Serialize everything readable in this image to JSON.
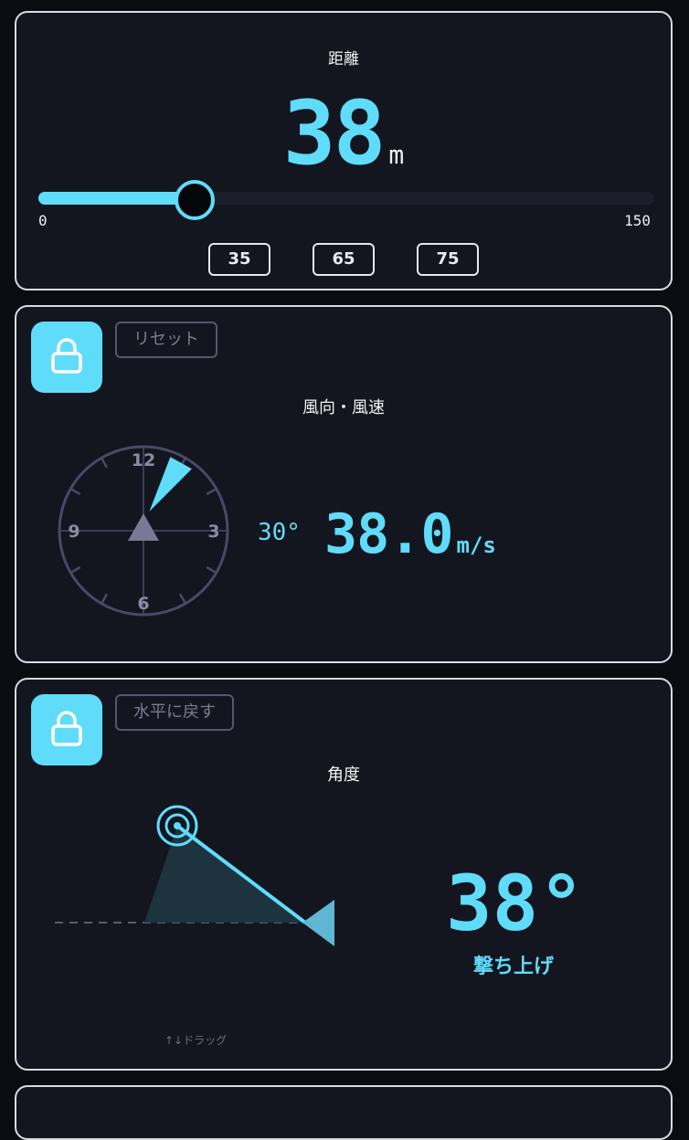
{
  "distance": {
    "label": "距離",
    "value": "38",
    "unit": "m",
    "slider": {
      "min": 0,
      "max": 150,
      "value": 38,
      "min_label": "0",
      "max_label": "150"
    },
    "presets": [
      "35",
      "65",
      "75"
    ]
  },
  "wind": {
    "lock_icon": "lock-icon",
    "reset_label": "リセット",
    "title": "風向・風速",
    "dial_labels": {
      "top": "12",
      "right": "3",
      "bottom": "6",
      "left": "9"
    },
    "direction_value": 30,
    "direction_label": "30°",
    "speed": "38.0",
    "speed_unit": "m/s"
  },
  "angle": {
    "lock_icon": "lock-icon",
    "level_label": "水平に戻す",
    "title": "角度",
    "value_label": "38°",
    "mode": "撃ち上げ",
    "drag_hint": "↑↓ドラッグ"
  },
  "colors": {
    "accent": "#5fdcfa",
    "background": "#0b0c11",
    "card": "#13151f",
    "card_border": "#d9dbe2",
    "muted": "#55586a"
  }
}
